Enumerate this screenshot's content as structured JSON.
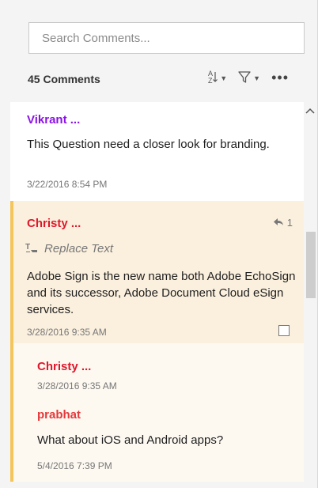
{
  "search": {
    "placeholder": "Search Comments..."
  },
  "header": {
    "count_label": "45 Comments",
    "sort_icon": "A↓Z",
    "filter_icon": "▽",
    "more": "•••"
  },
  "comments": [
    {
      "author": "Vikrant ...",
      "text": "This Question need a closer look for branding.",
      "time": "3/22/2016  8:54 PM"
    },
    {
      "author": "Christy ...",
      "reply_count": "1",
      "action": "Replace Text",
      "text": "Adobe Sign is the new name both Adobe EchoSign and its successor, Adobe Document Cloud eSign services.",
      "time": "3/28/2016  9:35 AM",
      "replies": [
        {
          "author": "Christy ...",
          "time": "3/28/2016  9:35 AM"
        },
        {
          "author": "prabhat",
          "text": "What about iOS and Android apps?",
          "time": "5/4/2016  7:39 PM"
        }
      ]
    }
  ],
  "colors": {
    "accent_bar": "#f4c55a",
    "author_purple": "#8a12e6",
    "author_red": "#e0162b"
  }
}
